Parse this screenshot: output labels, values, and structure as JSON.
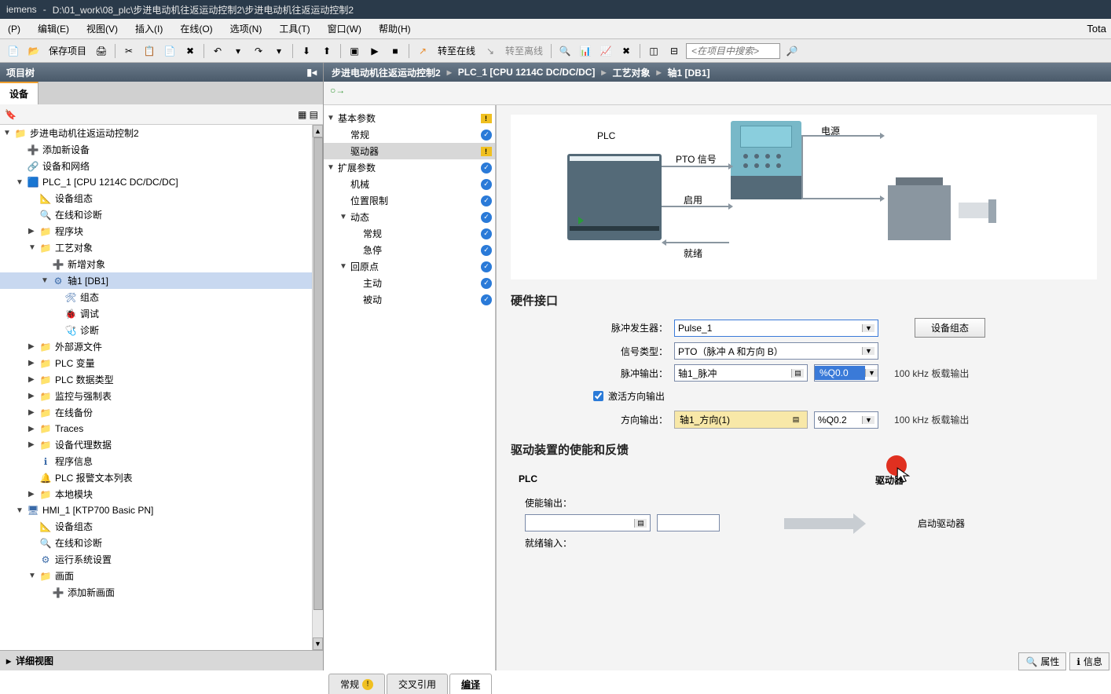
{
  "titlebar": {
    "app": "iemens",
    "separator": "-",
    "path": "D:\\01_work\\08_plc\\步进电动机往返运动控制2\\步进电动机往返运动控制2"
  },
  "menubar": {
    "items": [
      "(P)",
      "编辑(E)",
      "视图(V)",
      "插入(I)",
      "在线(O)",
      "选项(N)",
      "工具(T)",
      "窗口(W)",
      "帮助(H)"
    ],
    "top_right": "Tota"
  },
  "toolbar": {
    "save_label": "保存项目",
    "go_online": "转至在线",
    "go_offline": "转至离线",
    "search_placeholder": "<在项目中搜索>"
  },
  "left": {
    "header_title": "项目树",
    "tab": "设备",
    "details_view": "详细视图"
  },
  "project_tree": [
    {
      "level": 0,
      "caret": "▼",
      "icon": "project",
      "label": "步进电动机往返运动控制2"
    },
    {
      "level": 1,
      "caret": "",
      "icon": "add",
      "label": "添加新设备"
    },
    {
      "level": 1,
      "caret": "",
      "icon": "net",
      "label": "设备和网络"
    },
    {
      "level": 1,
      "caret": "▼",
      "icon": "plc",
      "label": "PLC_1 [CPU 1214C DC/DC/DC]"
    },
    {
      "level": 2,
      "caret": "",
      "icon": "devcfg",
      "label": "设备组态"
    },
    {
      "level": 2,
      "caret": "",
      "icon": "diag",
      "label": "在线和诊断"
    },
    {
      "level": 2,
      "caret": "▶",
      "icon": "folder",
      "label": "程序块"
    },
    {
      "level": 2,
      "caret": "▼",
      "icon": "folder",
      "label": "工艺对象"
    },
    {
      "level": 3,
      "caret": "",
      "icon": "add",
      "label": "新增对象"
    },
    {
      "level": 3,
      "caret": "▼",
      "icon": "axis",
      "label": "轴1 [DB1]",
      "selected": true
    },
    {
      "level": 4,
      "caret": "",
      "icon": "cfg",
      "label": "组态"
    },
    {
      "level": 4,
      "caret": "",
      "icon": "debug",
      "label": "调试"
    },
    {
      "level": 4,
      "caret": "",
      "icon": "diag2",
      "label": "诊断"
    },
    {
      "level": 2,
      "caret": "▶",
      "icon": "folder",
      "label": "外部源文件"
    },
    {
      "level": 2,
      "caret": "▶",
      "icon": "folder",
      "label": "PLC 变量"
    },
    {
      "level": 2,
      "caret": "▶",
      "icon": "folder",
      "label": "PLC 数据类型"
    },
    {
      "level": 2,
      "caret": "▶",
      "icon": "folder",
      "label": "监控与强制表"
    },
    {
      "level": 2,
      "caret": "▶",
      "icon": "folder",
      "label": "在线备份"
    },
    {
      "level": 2,
      "caret": "▶",
      "icon": "folder",
      "label": "Traces"
    },
    {
      "level": 2,
      "caret": "▶",
      "icon": "folder",
      "label": "设备代理数据"
    },
    {
      "level": 2,
      "caret": "",
      "icon": "info",
      "label": "程序信息"
    },
    {
      "level": 2,
      "caret": "",
      "icon": "alarm",
      "label": "PLC 报警文本列表"
    },
    {
      "level": 2,
      "caret": "▶",
      "icon": "folder",
      "label": "本地模块"
    },
    {
      "level": 1,
      "caret": "▼",
      "icon": "hmi",
      "label": "HMI_1 [KTP700 Basic PN]"
    },
    {
      "level": 2,
      "caret": "",
      "icon": "devcfg",
      "label": "设备组态"
    },
    {
      "level": 2,
      "caret": "",
      "icon": "diag",
      "label": "在线和诊断"
    },
    {
      "level": 2,
      "caret": "",
      "icon": "runtime",
      "label": "运行系统设置"
    },
    {
      "level": 2,
      "caret": "▼",
      "icon": "folder",
      "label": "画面"
    },
    {
      "level": 3,
      "caret": "",
      "icon": "add",
      "label": "添加新画面"
    }
  ],
  "breadcrumb": [
    "步进电动机往返运动控制2",
    "PLC_1 [CPU 1214C DC/DC/DC]",
    "工艺对象",
    "轴1 [DB1]"
  ],
  "config_tree": [
    {
      "level": 0,
      "caret": "▼",
      "label": "基本参数",
      "status": "warn"
    },
    {
      "level": 1,
      "caret": "",
      "label": "常规",
      "status": "ok"
    },
    {
      "level": 1,
      "caret": "",
      "label": "驱动器",
      "status": "warn",
      "selected": true
    },
    {
      "level": 0,
      "caret": "▼",
      "label": "扩展参数",
      "status": "ok"
    },
    {
      "level": 1,
      "caret": "",
      "label": "机械",
      "status": "ok"
    },
    {
      "level": 1,
      "caret": "",
      "label": "位置限制",
      "status": "ok"
    },
    {
      "level": 1,
      "caret": "▼",
      "label": "动态",
      "status": "ok"
    },
    {
      "level": 2,
      "caret": "",
      "label": "常规",
      "status": "ok"
    },
    {
      "level": 2,
      "caret": "",
      "label": "急停",
      "status": "ok"
    },
    {
      "level": 1,
      "caret": "▼",
      "label": "回原点",
      "status": "ok"
    },
    {
      "level": 2,
      "caret": "",
      "label": "主动",
      "status": "ok"
    },
    {
      "level": 2,
      "caret": "",
      "label": "被动",
      "status": "ok"
    }
  ],
  "diagram": {
    "plc_label": "PLC",
    "power_label": "电源",
    "motor_label": "电机",
    "signals": [
      "PTO 信号",
      "启用",
      "就绪"
    ]
  },
  "hardware_interface": {
    "title": "硬件接口",
    "pulse_gen_label": "脉冲发生器：",
    "pulse_gen_value": "Pulse_1",
    "signal_type_label": "信号类型：",
    "signal_type_value": "PTO（脉冲 A 和方向 B）",
    "pulse_out_label": "脉冲输出：",
    "pulse_out_name": "轴1_脉冲",
    "pulse_out_addr": "%Q0.0",
    "pulse_out_note": "100 kHz 板载输出",
    "activate_dir_label": "激活方向输出",
    "dir_out_label": "方向输出：",
    "dir_out_name": "轴1_方向(1)",
    "dir_out_addr": "%Q0.2",
    "dir_out_note": "100 kHz 板载输出",
    "device_config_btn": "设备组态"
  },
  "drive_feedback": {
    "title": "驱动装置的使能和反馈",
    "plc_sublabel": "PLC",
    "driver_sublabel": "驱动器",
    "enable_out_label": "使能输出：",
    "ready_in_label": "就绪输入：",
    "start_driver": "启动驱动器"
  },
  "bottom_bar": {
    "properties": "属性",
    "info": "信息"
  },
  "bottom_tabs": [
    "常规",
    "交叉引用",
    "编译"
  ]
}
